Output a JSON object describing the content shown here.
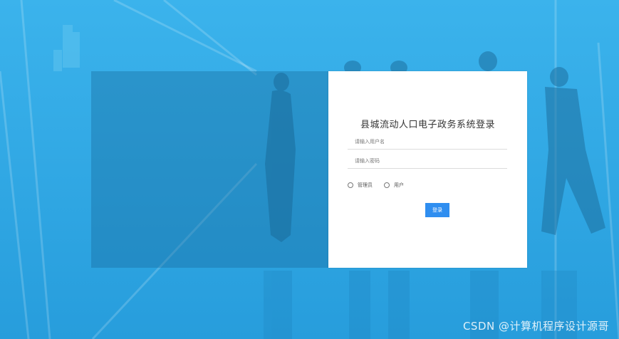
{
  "login": {
    "title": "县城流动人口电子政务系统登录",
    "username_placeholder": "请输入用户名",
    "password_placeholder": "请输入密码",
    "roles": [
      "管理员",
      "用户"
    ],
    "submit_label": "登录"
  },
  "watermark": "CSDN @计算机程序设计源哥",
  "colors": {
    "background": "#2ea8e8",
    "button": "#2f8ef0"
  }
}
